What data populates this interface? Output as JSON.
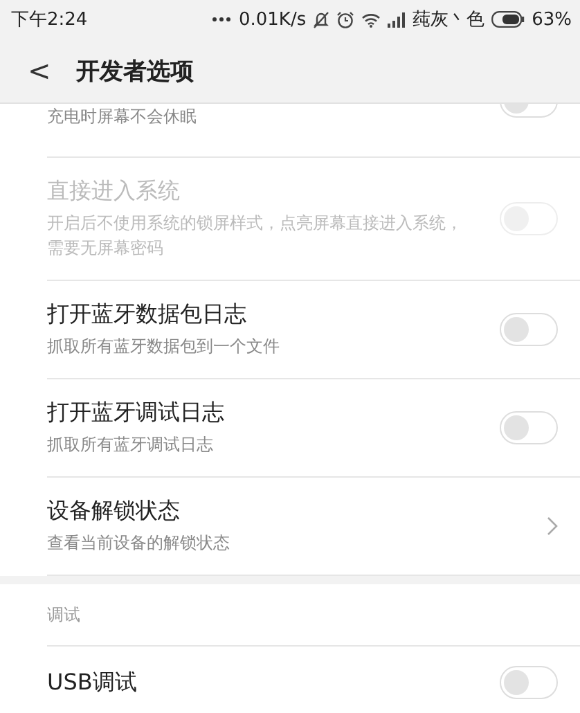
{
  "status_bar": {
    "time": "下午2:24",
    "speed": "0.01K/s",
    "carrier": "莼灰丶色",
    "battery": "63%"
  },
  "header": {
    "back": "<",
    "title": "开发者选项"
  },
  "items": [
    {
      "kind": "toggle",
      "subtitle": "充电时屏幕不会休眠",
      "on": false,
      "disabled": false,
      "partial": true
    },
    {
      "kind": "toggle",
      "title": "直接进入系统",
      "subtitle": "开启后不使用系统的锁屏样式，点亮屏幕直接进入系统，需要无屏幕密码",
      "on": false,
      "disabled": true
    },
    {
      "kind": "toggle",
      "title": "打开蓝牙数据包日志",
      "subtitle": "抓取所有蓝牙数据包到一个文件",
      "on": false,
      "disabled": false
    },
    {
      "kind": "toggle",
      "title": "打开蓝牙调试日志",
      "subtitle": "抓取所有蓝牙调试日志",
      "on": false,
      "disabled": false
    },
    {
      "kind": "link",
      "title": "设备解锁状态",
      "subtitle": "查看当前设备的解锁状态",
      "disabled": false
    },
    {
      "kind": "section",
      "title": "调试"
    },
    {
      "kind": "toggle",
      "title": "USB调试",
      "on": false,
      "disabled": false
    }
  ]
}
